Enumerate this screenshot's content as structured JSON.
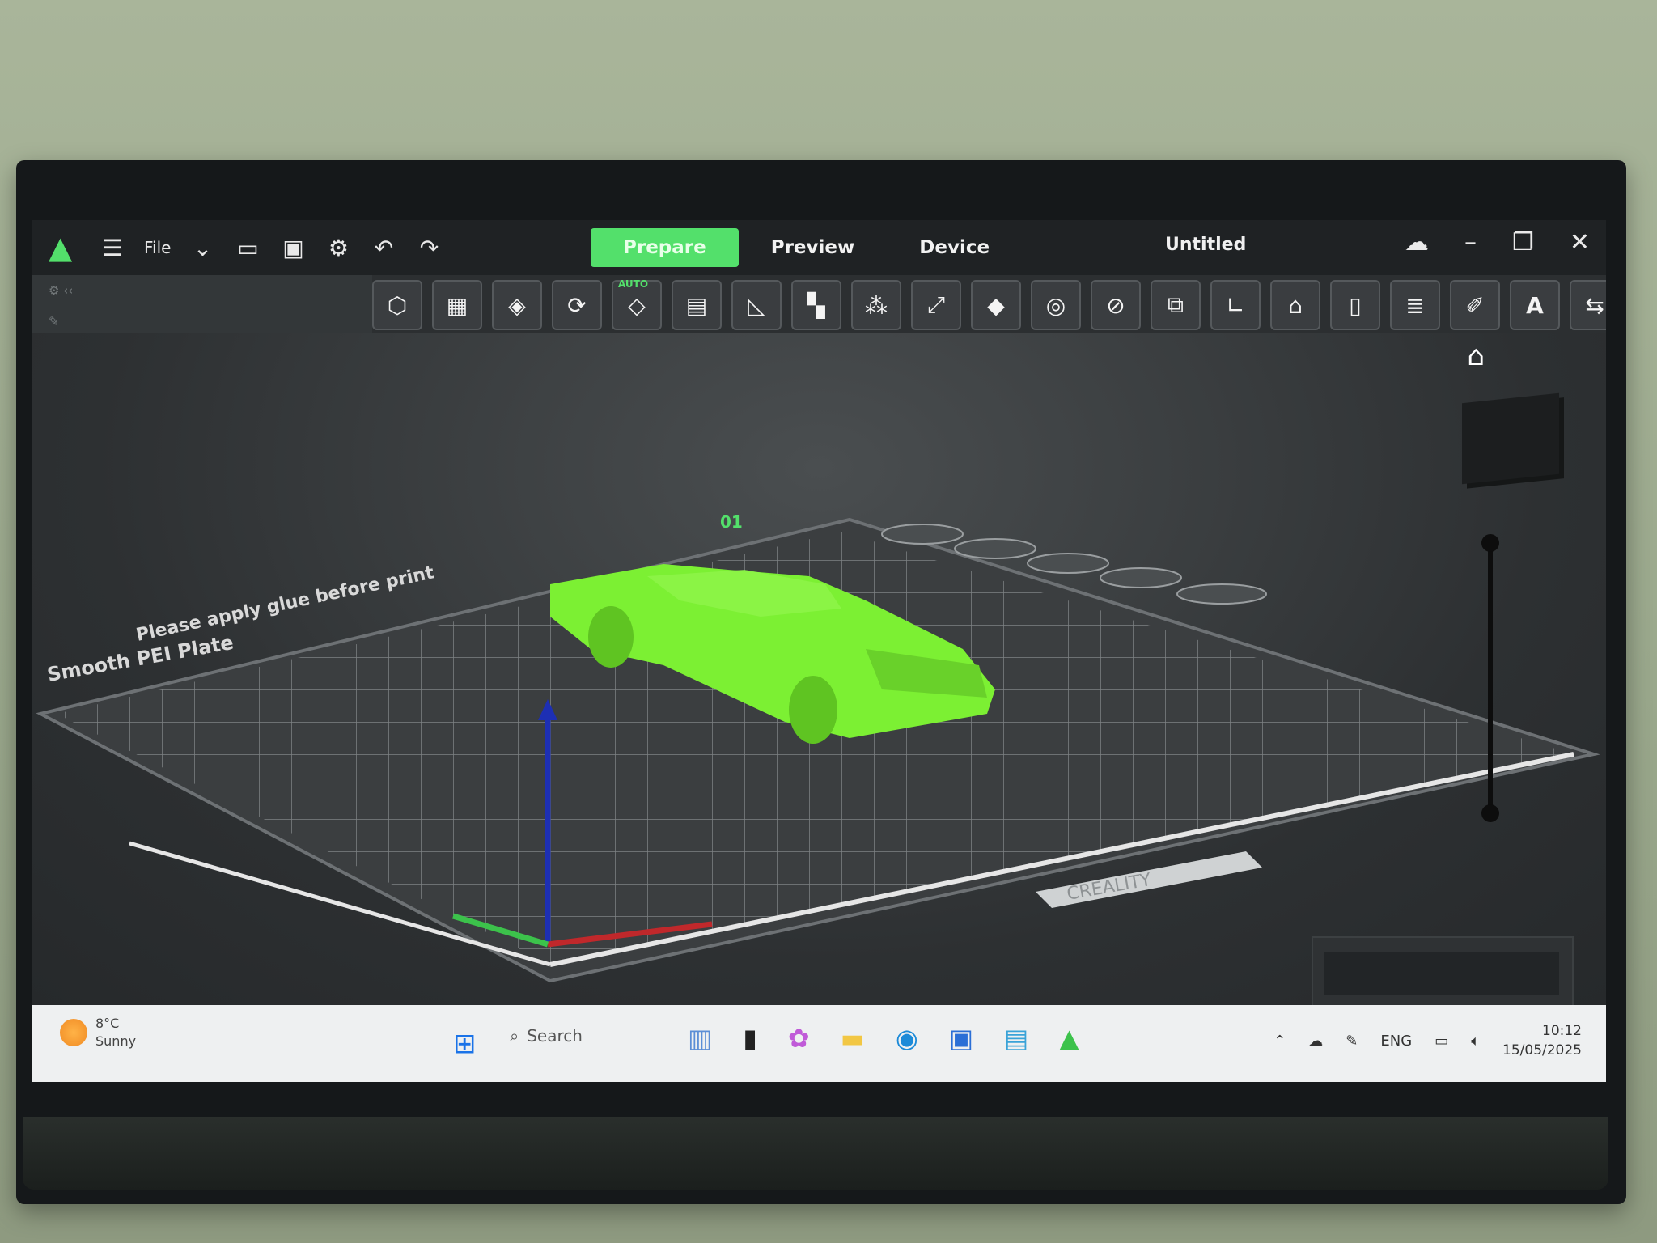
{
  "app": {
    "file_label": "File",
    "tabs": [
      "Prepare",
      "Preview",
      "Device"
    ],
    "active_tab": "Prepare",
    "window_title": "Untitled"
  },
  "toolbar": {
    "auto_badge": "AUTO"
  },
  "plate": {
    "label_1": "Please apply glue before print",
    "label_2": "Smooth PEI Plate",
    "plate_number": "01",
    "brand_text": "CREALITY"
  },
  "taskbar": {
    "weather_temp": "8°C",
    "weather_desc": "Sunny",
    "search_placeholder": "Search",
    "language": "ENG",
    "time": "10:12",
    "date": "15/05/2025"
  },
  "colors": {
    "accent": "#53e06b",
    "model": "#7cf033",
    "axis_x": "#c0282b",
    "axis_y": "#3cc24b",
    "axis_z": "#1d2fb4"
  }
}
